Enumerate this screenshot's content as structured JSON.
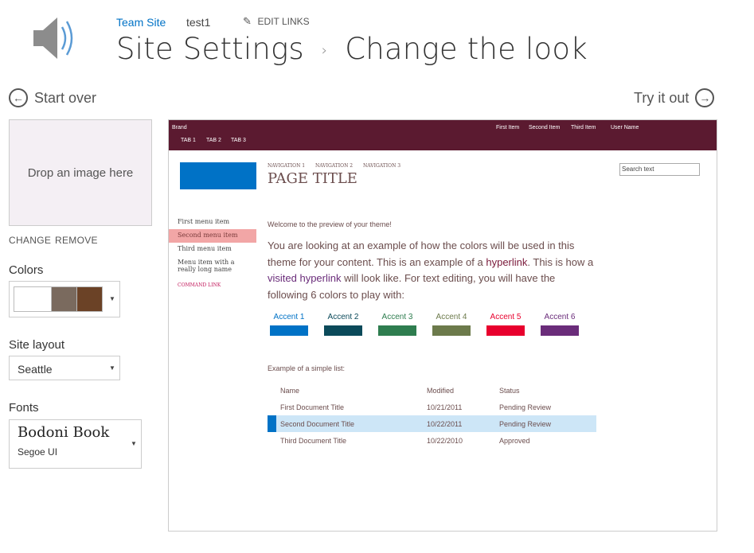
{
  "header": {
    "breadcrumb_site": "Team Site",
    "breadcrumb_test": "test1",
    "edit_links": "EDIT LINKS",
    "title_part1": "Site Settings",
    "separator": "›",
    "title_part2": "Change the look"
  },
  "actions": {
    "start_over": "Start over",
    "try_it_out": "Try it out"
  },
  "image_panel": {
    "drop_text": "Drop an image here",
    "change": "CHANGE",
    "remove": "REMOVE"
  },
  "colors": {
    "label": "Colors",
    "swatches": [
      "#ffffff",
      "#7a6a5e",
      "#6b4226"
    ]
  },
  "site_layout": {
    "label": "Site layout",
    "value": "Seattle"
  },
  "fonts": {
    "label": "Fonts",
    "heading_font": "Bodoni Book",
    "body_font": "Segoe UI"
  },
  "preview": {
    "brand": "Brand",
    "tabs": [
      "TAB 1",
      "TAB 2",
      "TAB 3"
    ],
    "top_items": [
      "First Item",
      "Second Item",
      "Third Item"
    ],
    "user_name": "User Name",
    "nav_links": [
      "NAVIGATION 1",
      "NAVIGATION 2",
      "NAVIGATION 3"
    ],
    "page_title": "PAGE TITLE",
    "search_placeholder": "Search text",
    "menu": [
      "First menu item",
      "Second menu item",
      "Third menu item",
      "Menu item with a",
      "really long name"
    ],
    "command_link": "COMMAND LINK",
    "welcome": "Welcome to the preview of your theme!",
    "para_1": "You are looking at an example of how the colors will be used in this",
    "para_2a": "theme for your content. This is an example of a ",
    "hyperlink": "hyperlink",
    "para_2b": ". This is how a",
    "visited": "visited hyperlink",
    "para_3": " will look like. For text editing, you will have the",
    "para_4": "following 6 colors to play with:",
    "accents": [
      {
        "label": "Accent 1",
        "color": "#0072c6"
      },
      {
        "label": "Accent 2",
        "color": "#0b4a5a"
      },
      {
        "label": "Accent 3",
        "color": "#2e7d4f"
      },
      {
        "label": "Accent 4",
        "color": "#6c7a4b"
      },
      {
        "label": "Accent 5",
        "color": "#e8002d"
      },
      {
        "label": "Accent 6",
        "color": "#6a2c7a"
      }
    ],
    "list_caption": "Example of a simple list:",
    "columns": [
      "Name",
      "Modified",
      "Status"
    ],
    "rows": [
      {
        "name": "First Document Title",
        "modified": "10/21/2011",
        "status": "Pending Review"
      },
      {
        "name": "Second Document Title",
        "modified": "10/22/2011",
        "status": "Pending Review"
      },
      {
        "name": "Third Document Title",
        "modified": "10/22/2010",
        "status": "Approved"
      }
    ]
  }
}
